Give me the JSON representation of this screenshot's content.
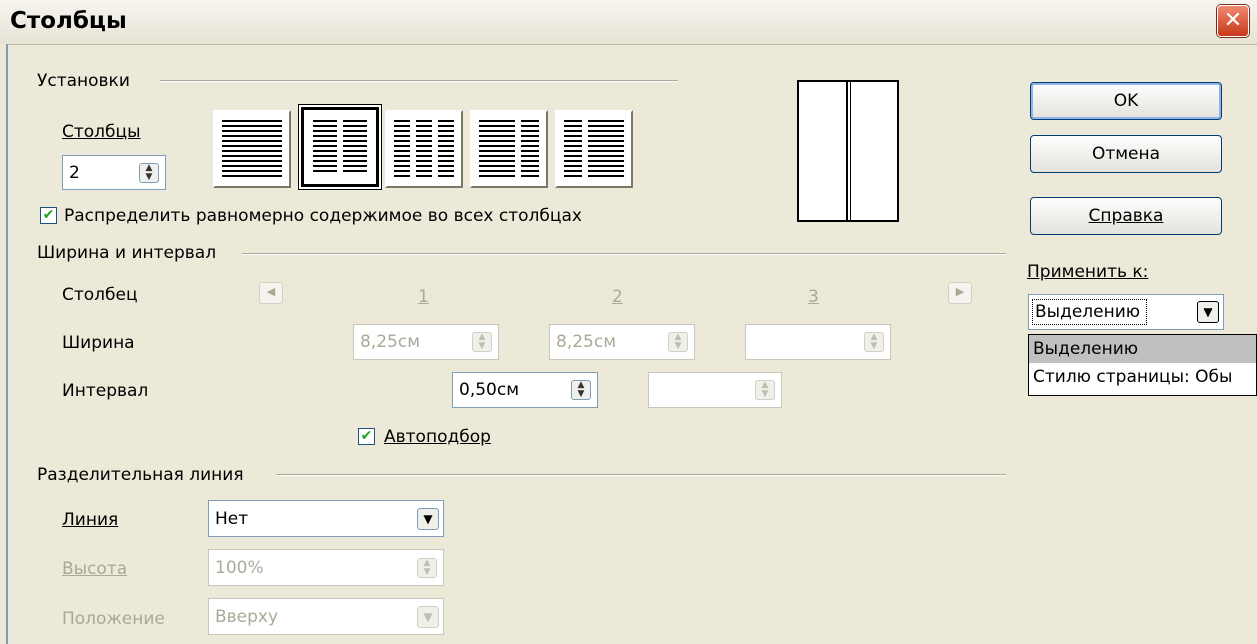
{
  "window": {
    "title": "Столбцы",
    "close_glyph": "✕"
  },
  "settings": {
    "group_label": "Установки",
    "columns_label": "Столбцы",
    "columns_value": "2",
    "distribute_checked": true,
    "distribute_label": "Распределить равномерно содержимое во всех столбцах"
  },
  "width_spacing": {
    "group_label": "Ширина и интервал",
    "column_label": "Столбец",
    "col_numbers": [
      "1",
      "2",
      "3"
    ],
    "width_label": "Ширина",
    "widths": [
      "8,25см",
      "8,25см",
      ""
    ],
    "spacing_label": "Интервал",
    "spacings": [
      "0,50см",
      ""
    ],
    "autofit_checked": true,
    "autofit_label": "Автоподбор"
  },
  "separator": {
    "group_label": "Разделительная линия",
    "line_label": "Линия",
    "line_value": "Нет",
    "height_label": "Высота",
    "height_value": "100%",
    "position_label": "Положение",
    "position_value": "Вверху"
  },
  "buttons": {
    "ok": "OK",
    "cancel": "Отмена",
    "help": "Справка"
  },
  "apply_to": {
    "label": "Применить к:",
    "value": "Выделению",
    "options": [
      "Выделению",
      "Стилю страницы: Обы"
    ]
  },
  "icons": {
    "spinner": "spinner-icon",
    "dropdown": "chevron-down-icon",
    "check": "checkmark-icon",
    "left": "arrow-left-icon",
    "right": "arrow-right-icon"
  }
}
